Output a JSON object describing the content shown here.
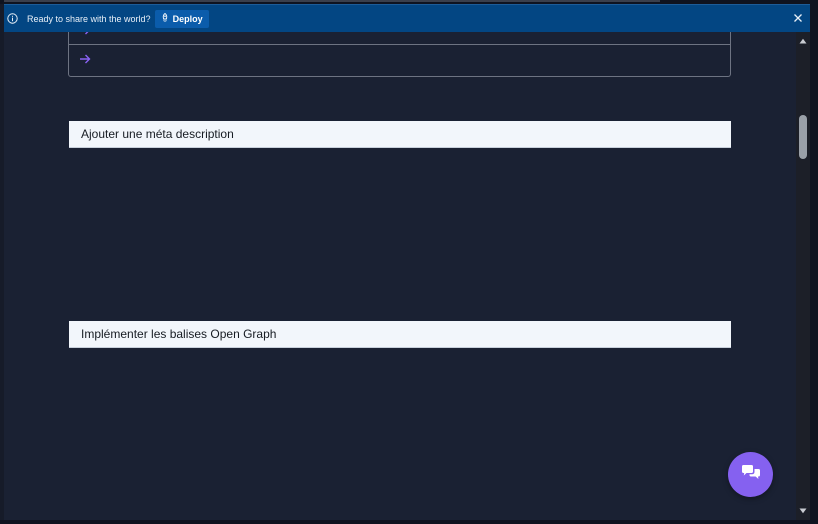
{
  "banner": {
    "message": "Ready to share with the world?",
    "deploy_label": "Deploy"
  },
  "link_rows": [
    {
      "text": ""
    },
    {
      "text": ""
    }
  ],
  "cards": [
    {
      "title": "Ajouter une méta description"
    },
    {
      "title": "Implémenter les balises Open Graph"
    }
  ],
  "colors": {
    "banner_bg": "#034683",
    "accent_purple": "#8561f0",
    "card_bg": "#f2f6fb",
    "page_bg": "#1a2133"
  },
  "icons": {
    "info": "info-icon",
    "deploy": "rocket-icon",
    "close": "close-icon",
    "arrow": "arrow-right-icon",
    "chat": "chat-bubbles-icon"
  }
}
